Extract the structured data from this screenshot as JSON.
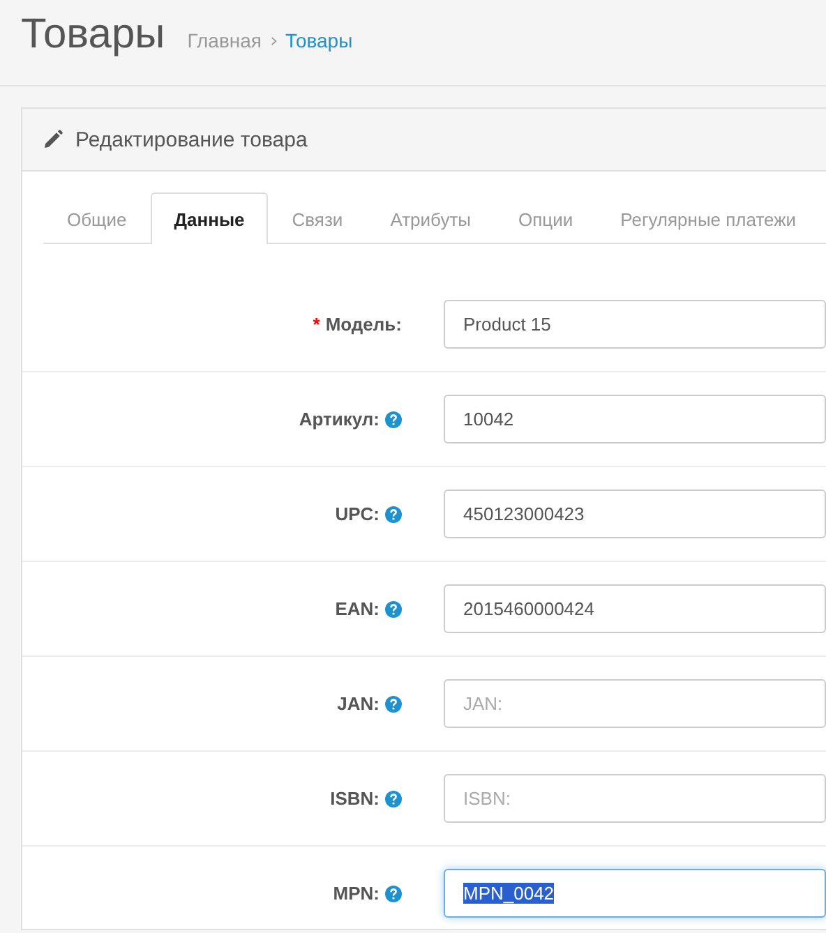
{
  "header": {
    "title": "Товары",
    "breadcrumb": [
      {
        "label": "Главная",
        "current": false
      },
      {
        "label": "Товары",
        "current": true
      }
    ]
  },
  "panel": {
    "title": "Редактирование товара"
  },
  "tabs": [
    {
      "label": "Общие",
      "selected": false
    },
    {
      "label": "Данные",
      "selected": true
    },
    {
      "label": "Связи",
      "selected": false
    },
    {
      "label": "Атрибуты",
      "selected": false
    },
    {
      "label": "Опции",
      "selected": false
    },
    {
      "label": "Регулярные платежи",
      "selected": false
    }
  ],
  "fields": [
    {
      "label": "Модель:",
      "required_mark": "*",
      "help": false,
      "value": "Product 15",
      "focused": false,
      "text_selected": false
    },
    {
      "label": "Артикул:",
      "help": true,
      "value": "10042",
      "focused": false,
      "text_selected": false
    },
    {
      "label": "UPC:",
      "help": true,
      "value": "450123000423",
      "focused": false,
      "text_selected": false
    },
    {
      "label": "EAN:",
      "help": true,
      "value": "2015460000424",
      "focused": false,
      "text_selected": false
    },
    {
      "label": "JAN:",
      "help": true,
      "placeholder": "JAN:",
      "focused": false,
      "text_selected": false
    },
    {
      "label": "ISBN:",
      "help": true,
      "placeholder": "ISBN:",
      "focused": false,
      "text_selected": false
    },
    {
      "label": "MPN:",
      "help": true,
      "value": "MPN_0042",
      "focused": true,
      "text_selected": true
    }
  ]
}
